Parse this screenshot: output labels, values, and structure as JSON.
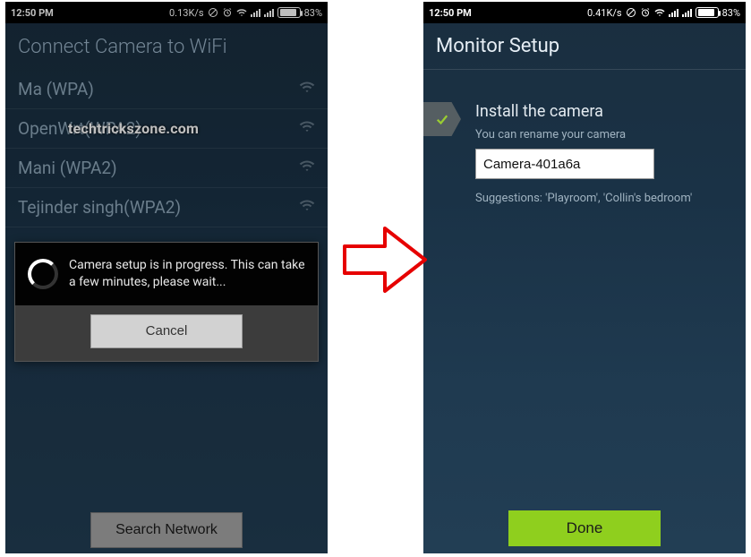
{
  "status": {
    "time": "12:50 PM",
    "speed_left": "0.13K/s",
    "speed_right": "0.41K/s",
    "battery_pct": "83%"
  },
  "left": {
    "title": "Connect Camera to WiFi",
    "watermark": "techtrickszone.com",
    "networks": [
      {
        "label": "Ma         (WPA)"
      },
      {
        "label": "OpenWrt(WPA2)"
      },
      {
        "label": "Mani          (WPA2)"
      },
      {
        "label": "Tejinder singh(WPA2)"
      }
    ],
    "dialog": {
      "message": "Camera setup is in progress. This can take a few minutes, please wait...",
      "cancel": "Cancel"
    },
    "search_btn": "Search Network"
  },
  "right": {
    "title": "Monitor Setup",
    "form_title": "Install the camera",
    "form_sub": "You can rename your camera",
    "camera_name": "Camera-401a6a",
    "suggestions": "Suggestions: 'Playroom', 'Collin's bedroom'",
    "done": "Done"
  }
}
